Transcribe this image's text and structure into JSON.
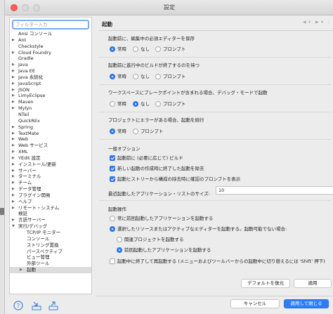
{
  "window": {
    "title": "設定"
  },
  "filter": {
    "placeholder": "フィルター入力"
  },
  "tree": [
    {
      "label": "Ansi コンソール",
      "level": 0,
      "arrow": ""
    },
    {
      "label": "Ant",
      "level": 0,
      "arrow": "▶"
    },
    {
      "label": "Checkstyle",
      "level": 0,
      "arrow": ""
    },
    {
      "label": "Cloud Foundry",
      "level": 0,
      "arrow": "▶"
    },
    {
      "label": "Gradle",
      "level": 0,
      "arrow": ""
    },
    {
      "label": "Java",
      "level": 0,
      "arrow": "▶"
    },
    {
      "label": "Java EE",
      "level": 0,
      "arrow": "▶"
    },
    {
      "label": "Java 永続化",
      "level": 0,
      "arrow": "▶"
    },
    {
      "label": "JavaScript",
      "level": 0,
      "arrow": "▶"
    },
    {
      "label": "JSON",
      "level": 0,
      "arrow": "▶"
    },
    {
      "label": "LimyEclipse",
      "level": 0,
      "arrow": "▶"
    },
    {
      "label": "Maven",
      "level": 0,
      "arrow": "▶"
    },
    {
      "label": "Mylyn",
      "level": 0,
      "arrow": "▶"
    },
    {
      "label": "NTail",
      "level": 0,
      "arrow": ""
    },
    {
      "label": "QuickREx",
      "level": 0,
      "arrow": ""
    },
    {
      "label": "Spring",
      "level": 0,
      "arrow": "▶"
    },
    {
      "label": "TextMate",
      "level": 0,
      "arrow": "▶"
    },
    {
      "label": "Web",
      "level": 0,
      "arrow": "▶"
    },
    {
      "label": "Web サービス",
      "level": 0,
      "arrow": "▶"
    },
    {
      "label": "XML",
      "level": 0,
      "arrow": "▶"
    },
    {
      "label": "YEdit 設定",
      "level": 0,
      "arrow": "▶"
    },
    {
      "label": "インストール/更新",
      "level": 0,
      "arrow": "▶"
    },
    {
      "label": "サーバー",
      "level": 0,
      "arrow": "▶"
    },
    {
      "label": "ターミナル",
      "level": 0,
      "arrow": "▶"
    },
    {
      "label": "チーム",
      "level": 0,
      "arrow": "▶"
    },
    {
      "label": "データ管理",
      "level": 0,
      "arrow": "▶"
    },
    {
      "label": "プラグイン開発",
      "level": 0,
      "arrow": "▶"
    },
    {
      "label": "ヘルプ",
      "level": 0,
      "arrow": "▶"
    },
    {
      "label": "リモート・システム",
      "level": 0,
      "arrow": "▶"
    },
    {
      "label": "検証",
      "level": 0,
      "arrow": ""
    },
    {
      "label": "言語サーバー",
      "level": 0,
      "arrow": "▶"
    },
    {
      "label": "実行/デバッグ",
      "level": 0,
      "arrow": "▼"
    },
    {
      "label": "TCP/IP モニター",
      "level": 1,
      "arrow": ""
    },
    {
      "label": "コンソール",
      "level": 1,
      "arrow": ""
    },
    {
      "label": "ストリング置換",
      "level": 1,
      "arrow": ""
    },
    {
      "label": "パースペクティブ",
      "level": 1,
      "arrow": ""
    },
    {
      "label": "ビュー管理",
      "level": 1,
      "arrow": ""
    },
    {
      "label": "外部ツール",
      "level": 1,
      "arrow": ""
    },
    {
      "label": "起動",
      "level": 1,
      "arrow": "▶",
      "selected": true
    }
  ],
  "page": {
    "title": "起動",
    "q1": {
      "label": "起動前に、編集中の必須エディターを保存",
      "opt_always": "常時",
      "opt_never": "なし",
      "opt_prompt": "プロンプト"
    },
    "q2": {
      "label": "起動前に進行中のビルドが終了するのを待つ",
      "opt_always": "常時",
      "opt_never": "なし",
      "opt_prompt": "プロンプト"
    },
    "q3": {
      "label": "ワークスペースにブレークポイントが含まれる場合、デバッグ・モードで起動",
      "opt_always": "常時",
      "opt_never": "なし",
      "opt_prompt": "プロンプト"
    },
    "q4": {
      "label": "プロジェクトにエラーがある場合、起動を続行",
      "opt_always": "常時",
      "opt_prompt": "プロンプト"
    },
    "general": {
      "heading": "一般オプション",
      "build_before": "起動前に (必要に応じて) ビルド",
      "remove_terminated": "新しい起動の作成時に終了した起動を除去",
      "confirm_prompt": "起動ヒストリーから構成の除去時に確認のプロンプトを表示",
      "recent_label": "最近起動したアプリケーション・リストのサイズ:",
      "recent_value": "10"
    },
    "launch": {
      "heading": "起動操作",
      "always_prev": "常に前回起動したアプリケーションを起動する",
      "selected_resource": "選択したリソースまたはアクティブなエディターを起動する。起動可能でない場合:",
      "related_project": "関連プロジェクトを起動する",
      "prev_app": "前回起動したアプリケーションを起動する",
      "terminate_relaunch": "起動中に終了して再起動する (メニューおよびツールバーからの起動中に切り替えるには 'Shift' 押下)"
    },
    "restore_defaults": "デフォルトを復元",
    "apply": "適用"
  },
  "footer": {
    "cancel": "キャンセル",
    "apply_close": "適用して閉じる"
  },
  "colors": {
    "accent": "#2f7cf6",
    "close_light": "#fd5f57"
  },
  "icons": [
    "help-icon",
    "import-icon",
    "export-icon"
  ]
}
